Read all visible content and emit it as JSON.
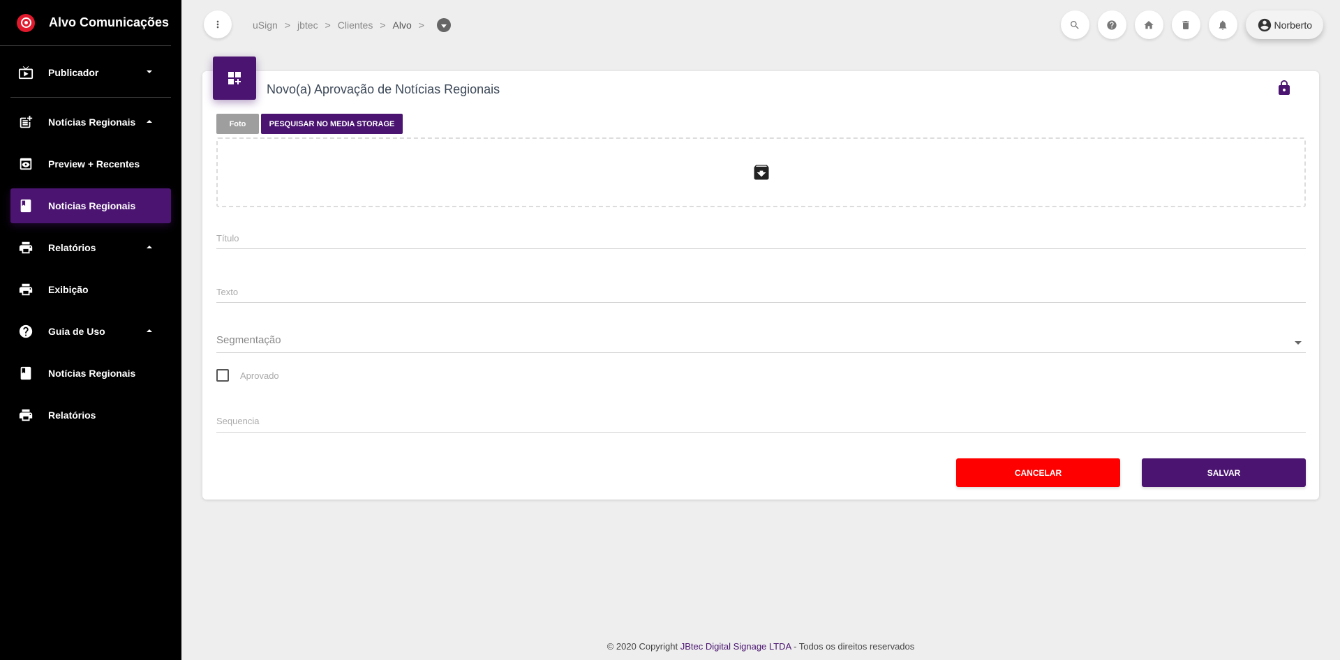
{
  "sidebar": {
    "brand": "Alvo Comunicações",
    "items": [
      {
        "label": "Publicador"
      },
      {
        "label": "Notícias Regionais"
      },
      {
        "label": "Preview + Recentes"
      },
      {
        "label": "Noticias Regionais"
      },
      {
        "label": "Relatórios"
      },
      {
        "label": "Exibição"
      },
      {
        "label": "Guia de Uso"
      },
      {
        "label": "Notícias Regionais"
      },
      {
        "label": "Relatórios"
      }
    ]
  },
  "breadcrumb": {
    "items": [
      "uSign",
      "jbtec",
      "Clientes",
      "Alvo"
    ],
    "separator": ">"
  },
  "user": {
    "name": "Norberto"
  },
  "card": {
    "title": "Novo(a) Aprovação de Notícias Regionais",
    "tab_foto": "Foto",
    "tab_media": "PESQUISAR NO MEDIA STORAGE",
    "field_titulo": "Título",
    "field_texto": "Texto",
    "field_segmentacao": "Segmentação",
    "checkbox_aprovado": "Aprovado",
    "field_sequencia": "Sequencia",
    "cancel_label": "CANCELAR",
    "save_label": "SALVAR"
  },
  "footer": {
    "prefix": "© 2020 Copyright",
    "company": "JBtec Digital Signage LTDA",
    "suffix": " - Todos os direitos reservados"
  },
  "colors": {
    "primary": "#4a1470",
    "danger": "#ff0000",
    "sidebar_bg": "#000000",
    "brand_logo": "#e0192d"
  }
}
